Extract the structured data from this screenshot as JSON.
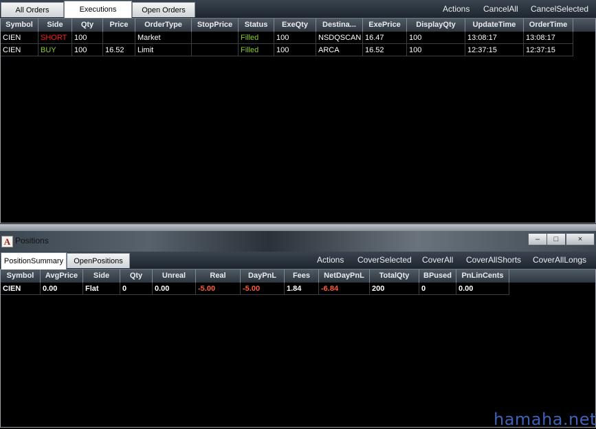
{
  "orders": {
    "tabs": [
      {
        "label": "All Orders",
        "active": false
      },
      {
        "label": "Executions",
        "active": true
      },
      {
        "label": "Open Orders",
        "active": false
      }
    ],
    "actions": [
      "Actions",
      "CancelAll",
      "CancelSelected"
    ],
    "columns": [
      "Symbol",
      "Side",
      "Qty",
      "Price",
      "OrderType",
      "StopPrice",
      "Status",
      "ExeQty",
      "Destina...",
      "ExePrice",
      "DisplayQty",
      "UpdateTime",
      "OrderTime"
    ],
    "rows": [
      {
        "symbol": "CIEN",
        "side": "SHORT",
        "qty": "100",
        "price": "",
        "order_type": "Market",
        "stop_price": "",
        "status": "Filled",
        "exe_qty": "100",
        "destination": "NSDQSCAN",
        "exe_price": "16.47",
        "display_qty": "100",
        "update_time": "13:08:17",
        "order_time": "13:08:17"
      },
      {
        "symbol": "CIEN",
        "side": "BUY",
        "qty": "100",
        "price": "16.52",
        "order_type": "Limit",
        "stop_price": "",
        "status": "Filled",
        "exe_qty": "100",
        "destination": "ARCA",
        "exe_price": "16.52",
        "display_qty": "100",
        "update_time": "12:37:15",
        "order_time": "12:37:15"
      }
    ]
  },
  "positions_window": {
    "title": "Positions",
    "app_icon_letter": "A",
    "controls": {
      "minimize": "–",
      "maximize": "□",
      "close": "×"
    }
  },
  "positions": {
    "tabs": [
      {
        "label": "PositionSummary",
        "active": true
      },
      {
        "label": "OpenPositions",
        "active": false
      }
    ],
    "actions": [
      "Actions",
      "CoverSelected",
      "CoverAll",
      "CoverAllShorts",
      "CoverAllLongs"
    ],
    "columns": [
      "Symbol",
      "AvgPrice",
      "Side",
      "Qty",
      "Unreal",
      "Real",
      "DayPnL",
      "Fees",
      "NetDayPnL",
      "TotalQty",
      "BPused",
      "PnLinCents"
    ],
    "rows": [
      {
        "symbol": "CIEN",
        "avg_price": "0.00",
        "side": "Flat",
        "qty": "0",
        "unreal": "0.00",
        "real": "-5.00",
        "day_pnl": "-5.00",
        "fees": "1.84",
        "net_day_pnl": "-6.84",
        "total_qty": "200",
        "bp_used": "0",
        "pnl_in_cents": "0.00"
      }
    ]
  },
  "watermark": "hamaha.net",
  "colors": {
    "short_side": "#ff1f1f",
    "buy_side": "#8dcc2a",
    "filled_status": "#8dcc2a",
    "negative_value": "#ff5a36",
    "watermark": "#3f62b8"
  }
}
